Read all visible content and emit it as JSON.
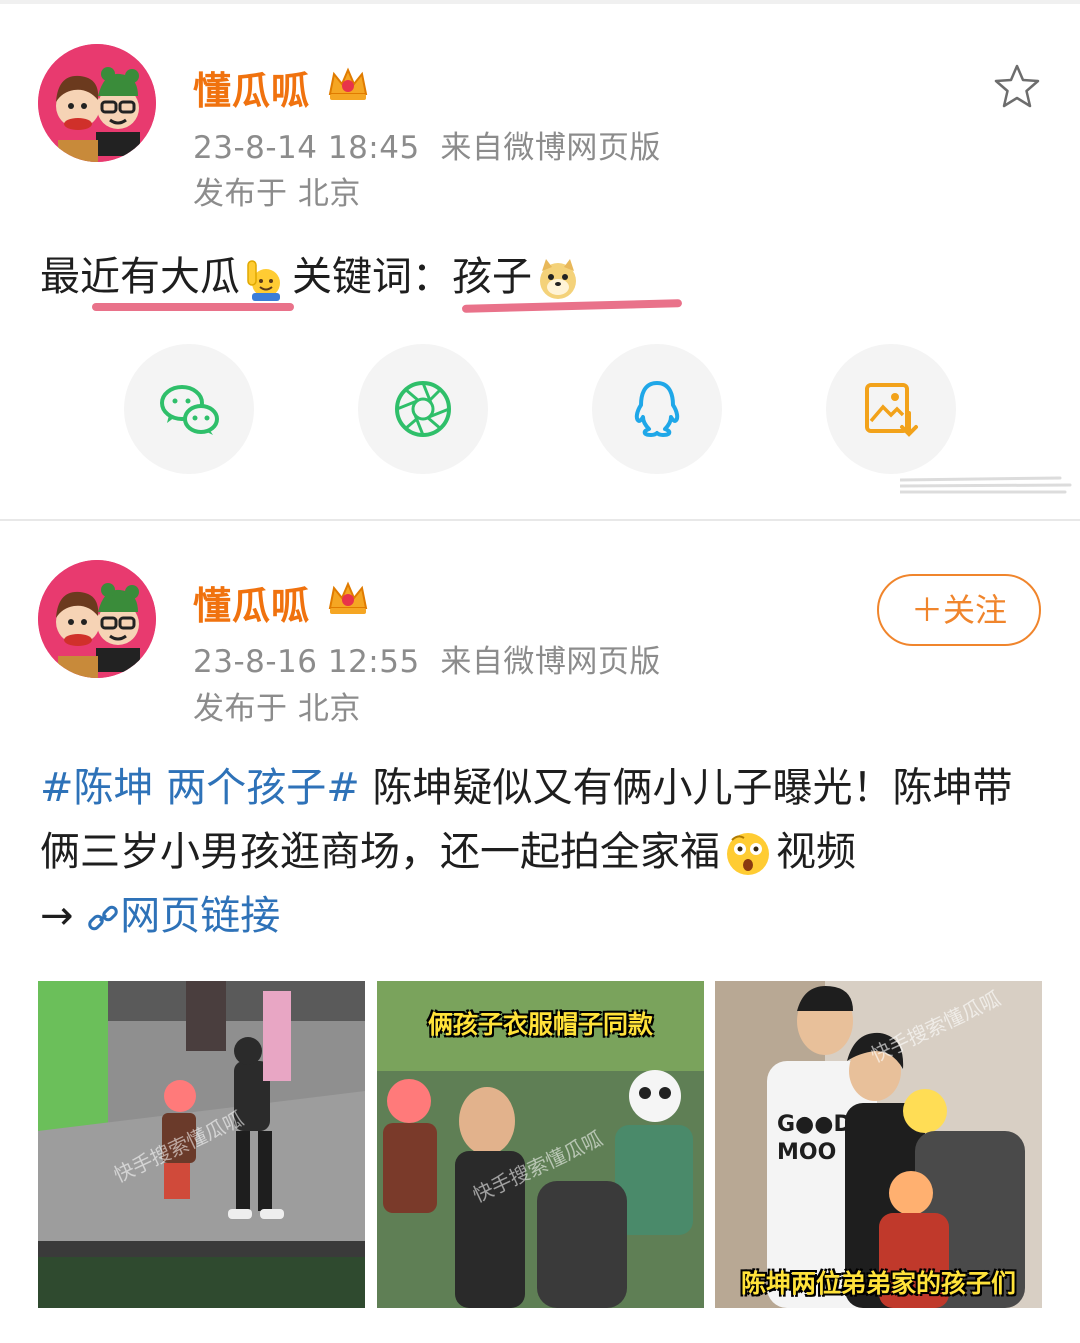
{
  "posts": [
    {
      "username": "懂瓜呱",
      "timestamp": "23-8-14 18:45",
      "source": "来自微博网页版",
      "location": "发布于 北京",
      "text_a": "最近有大瓜",
      "text_b": "关键词：",
      "text_c": "孩子",
      "share_buttons": [
        "wechat-icon",
        "moments-icon",
        "qq-icon",
        "save-image-icon"
      ]
    },
    {
      "username": "懂瓜呱",
      "timestamp": "23-8-16 12:55",
      "source": "来自微博网页版",
      "location": "发布于 北京",
      "follow_label": "＋关注",
      "hashtag": "#陈坤 两个孩子#",
      "body_a": "陈坤疑似又有俩小儿子曝光！陈坤带俩三岁小男孩逛商场，还一起拍全家福",
      "body_b": "视频",
      "arrow": "→",
      "link_text": "网页链接",
      "photos": [
        {
          "caption": "",
          "watermark": "快手搜索懂瓜呱"
        },
        {
          "caption": "俩孩子衣服帽子同款",
          "watermark": "快手搜索懂瓜呱"
        },
        {
          "caption": "陈坤两位弟弟家的孩子们",
          "watermark": "快手搜索懂瓜呱"
        }
      ]
    }
  ],
  "colors": {
    "username": "#f0720e",
    "link": "#2e72b8",
    "follow": "#f0852c",
    "underline": "#e9728a"
  }
}
